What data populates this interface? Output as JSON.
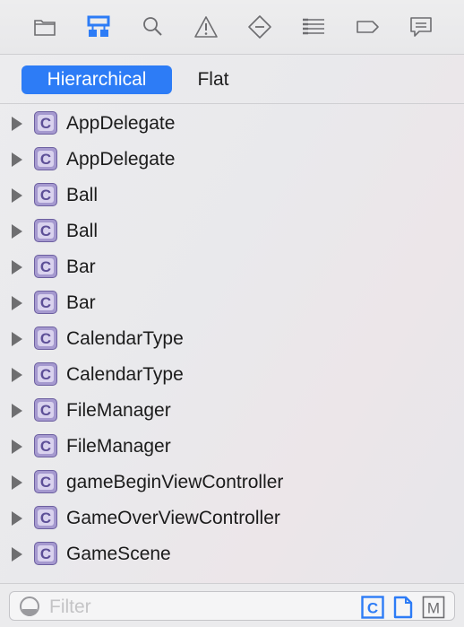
{
  "toolbar": {
    "icons": [
      {
        "name": "folder-icon"
      },
      {
        "name": "hierarchy-icon",
        "active": true
      },
      {
        "name": "search-icon"
      },
      {
        "name": "warning-icon"
      },
      {
        "name": "breakpoint-diamond-icon"
      },
      {
        "name": "list-icon"
      },
      {
        "name": "tag-icon"
      },
      {
        "name": "speech-bubble-icon"
      }
    ],
    "accent_color": "#2d7cf6"
  },
  "segmented": {
    "active_label": "Hierarchical",
    "inactive_label": "Flat"
  },
  "list": {
    "badge_letter": "C",
    "items": [
      "AppDelegate",
      "AppDelegate",
      "Ball",
      "Ball",
      "Bar",
      "Bar",
      "CalendarType",
      "CalendarType",
      "FileManager",
      "FileManager",
      "gameBeginViewController",
      "GameOverViewController",
      "GameScene"
    ]
  },
  "filter": {
    "placeholder": "Filter",
    "scope_buttons": [
      {
        "label": "C",
        "active": true
      },
      {
        "label": "file",
        "active": true
      },
      {
        "label": "M",
        "active": false
      }
    ]
  }
}
